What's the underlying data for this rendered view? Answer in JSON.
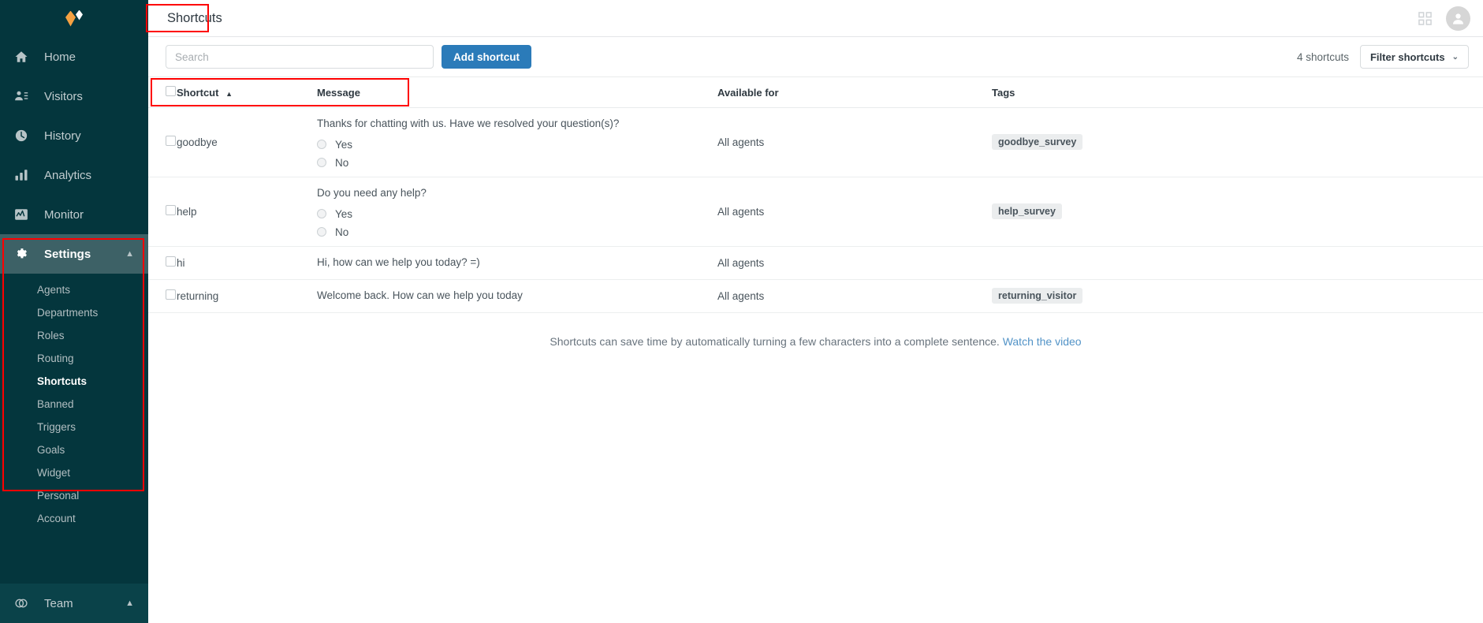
{
  "sidebar": {
    "logo_name": "zendesk-chat-logo",
    "items": [
      {
        "label": "Home",
        "icon": "home-icon"
      },
      {
        "label": "Visitors",
        "icon": "visitors-icon"
      },
      {
        "label": "History",
        "icon": "history-clock-icon"
      },
      {
        "label": "Analytics",
        "icon": "analytics-bars-icon"
      },
      {
        "label": "Monitor",
        "icon": "monitor-wave-icon"
      }
    ],
    "settings": {
      "label": "Settings",
      "icon": "gear-icon",
      "chevron": "▲",
      "expanded": true,
      "sub_items": [
        {
          "label": "Agents",
          "active": false
        },
        {
          "label": "Departments",
          "active": false
        },
        {
          "label": "Roles",
          "active": false
        },
        {
          "label": "Routing",
          "active": false
        },
        {
          "label": "Shortcuts",
          "active": true
        },
        {
          "label": "Banned",
          "active": false
        },
        {
          "label": "Triggers",
          "active": false
        },
        {
          "label": "Goals",
          "active": false
        },
        {
          "label": "Widget",
          "active": false
        },
        {
          "label": "Personal",
          "active": false
        },
        {
          "label": "Account",
          "active": false
        }
      ]
    },
    "team": {
      "label": "Team",
      "icon": "team-icon",
      "chevron": "▲"
    }
  },
  "header": {
    "title": "Shortcuts",
    "apps_icon": "apps-grid-icon",
    "avatar_icon": "user-avatar-icon"
  },
  "toolbar": {
    "search_placeholder": "Search",
    "search_value": "",
    "add_label": "Add shortcut",
    "count_label": "4 shortcuts",
    "filter_label": "Filter shortcuts",
    "filter_caret": "⌄"
  },
  "table": {
    "columns": {
      "shortcut": "Shortcut",
      "sort_indicator": "▲",
      "message": "Message",
      "available_for": "Available for",
      "tags": "Tags"
    },
    "rows": [
      {
        "shortcut": "goodbye",
        "message": "Thanks for chatting with us. Have we resolved your question(s)?",
        "options": [
          "Yes",
          "No"
        ],
        "available_for": "All agents",
        "tag": "goodbye_survey"
      },
      {
        "shortcut": "help",
        "message": "Do you need any help?",
        "options": [
          "Yes",
          "No"
        ],
        "available_for": "All agents",
        "tag": "help_survey"
      },
      {
        "shortcut": "hi",
        "message": "Hi, how can we help you today? =)",
        "options": [],
        "available_for": "All agents",
        "tag": ""
      },
      {
        "shortcut": "returning",
        "message": "Welcome back. How can we help you today",
        "options": [],
        "available_for": "All agents",
        "tag": "returning_visitor"
      }
    ]
  },
  "footer": {
    "note": "Shortcuts can save time by automatically turning a few characters into a complete sentence.",
    "link": "Watch the video"
  },
  "colors": {
    "sidebar_bg": "#04363d",
    "sidebar_active": "#3d6166",
    "accent_blue": "#2b7bb9",
    "link_blue": "#5293c7",
    "tag_bg": "#ebedee",
    "annotation_red": "#fe0000",
    "logo_orange": "#f5a142"
  }
}
